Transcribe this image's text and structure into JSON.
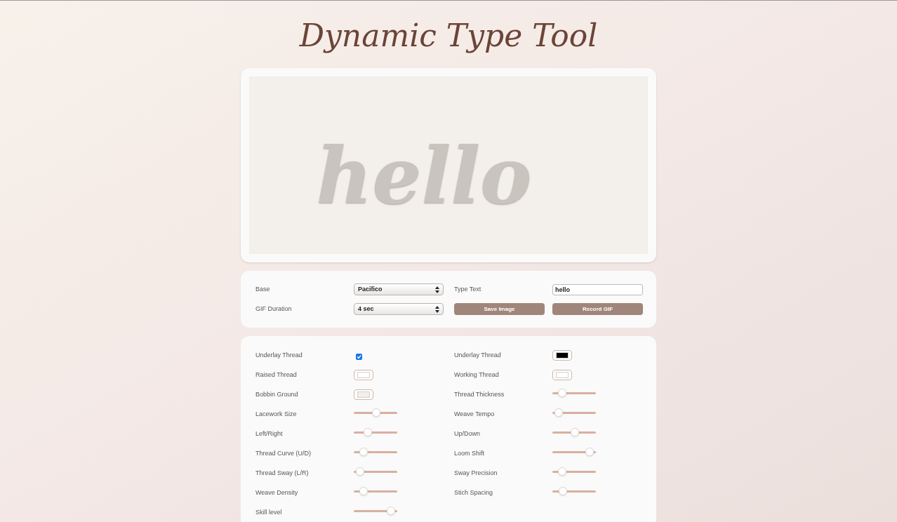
{
  "title": "Dynamic Type Tool",
  "preview": {
    "text": "hello"
  },
  "options": {
    "base": {
      "label": "Base",
      "value": "Pacifico"
    },
    "type_text": {
      "label": "Type Text",
      "value": "hello"
    },
    "gif_duration": {
      "label": "GIF Duration",
      "value": "4 sec"
    },
    "buttons": [
      "Save Image",
      "Record GIF"
    ]
  },
  "settings": [
    {
      "label": "Underlay Thread",
      "kind": "checkbox",
      "checked": true
    },
    {
      "label": "Underlay Thread",
      "kind": "color",
      "color": "#000000"
    },
    {
      "label": "Raised Thread",
      "kind": "color",
      "color": "#ffffff"
    },
    {
      "label": "Working Thread",
      "kind": "color",
      "color": "#ffffff"
    },
    {
      "label": "Bobbin Ground",
      "kind": "color",
      "color": "#f3eee9"
    },
    {
      "label": "Thread Thickness",
      "kind": "slider",
      "level": 0.15
    },
    {
      "label": "Lacework Size",
      "kind": "slider",
      "level": 0.52
    },
    {
      "label": "Weave Tempo",
      "kind": "slider",
      "level": 0.05
    },
    {
      "label": "Left/Right",
      "kind": "slider",
      "level": 0.28
    },
    {
      "label": "Up/Down",
      "kind": "slider",
      "level": 0.52
    },
    {
      "label": "Thread Curve (U/D)",
      "kind": "slider",
      "level": 0.15
    },
    {
      "label": "Loom Shift",
      "kind": "slider",
      "level": 0.93
    },
    {
      "label": "Thread Sway (L/R)",
      "kind": "slider",
      "level": 0.06
    },
    {
      "label": "Sway Precision",
      "kind": "slider",
      "level": 0.15
    },
    {
      "label": "Weave Density",
      "kind": "slider",
      "level": 0.15
    },
    {
      "label": "Stich Spacing",
      "kind": "slider",
      "level": 0.18
    },
    {
      "label": "Skill level",
      "kind": "slider",
      "level": 0.93
    }
  ]
}
